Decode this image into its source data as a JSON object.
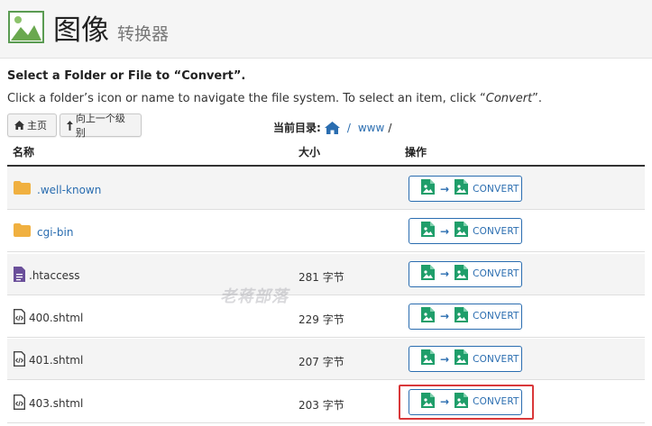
{
  "header": {
    "title": "图像",
    "subtitle": "转换器",
    "icon": "image-icon"
  },
  "instructions": {
    "title": "Select a Folder or File to “Convert”.",
    "text_before": "Click a folder’s icon or name to navigate the file system. To select an item, click “",
    "text_em": "Convert",
    "text_after": "”."
  },
  "nav": {
    "home_label": "主页",
    "up_label": "向上一个级别",
    "current_dir_label": "当前目录:",
    "path_sep1": "/",
    "path_dir": "www",
    "path_sep2": "/"
  },
  "columns": {
    "name": "名称",
    "size": "大小",
    "actions": "操作"
  },
  "rows": [
    {
      "name": ".well-known",
      "size": "",
      "icon": "folder-icon"
    },
    {
      "name": "cgi-bin",
      "size": "",
      "icon": "folder-icon"
    },
    {
      "name": ".htaccess",
      "size": "281 字节",
      "icon": "text-file-icon"
    },
    {
      "name": "400.shtml",
      "size": "229 字节",
      "icon": "code-file-icon"
    },
    {
      "name": "401.shtml",
      "size": "207 字节",
      "icon": "code-file-icon"
    },
    {
      "name": "403.shtml",
      "size": "203 字节",
      "icon": "code-file-icon"
    }
  ],
  "convert_label": "CONVERT",
  "watermark": "老蒋部落",
  "colors": {
    "accent": "#2a6db0",
    "folder": "#f0b040",
    "file": "#6a4f9a",
    "convert_icon": "#1f9e6a",
    "highlight": "#d9383a"
  }
}
